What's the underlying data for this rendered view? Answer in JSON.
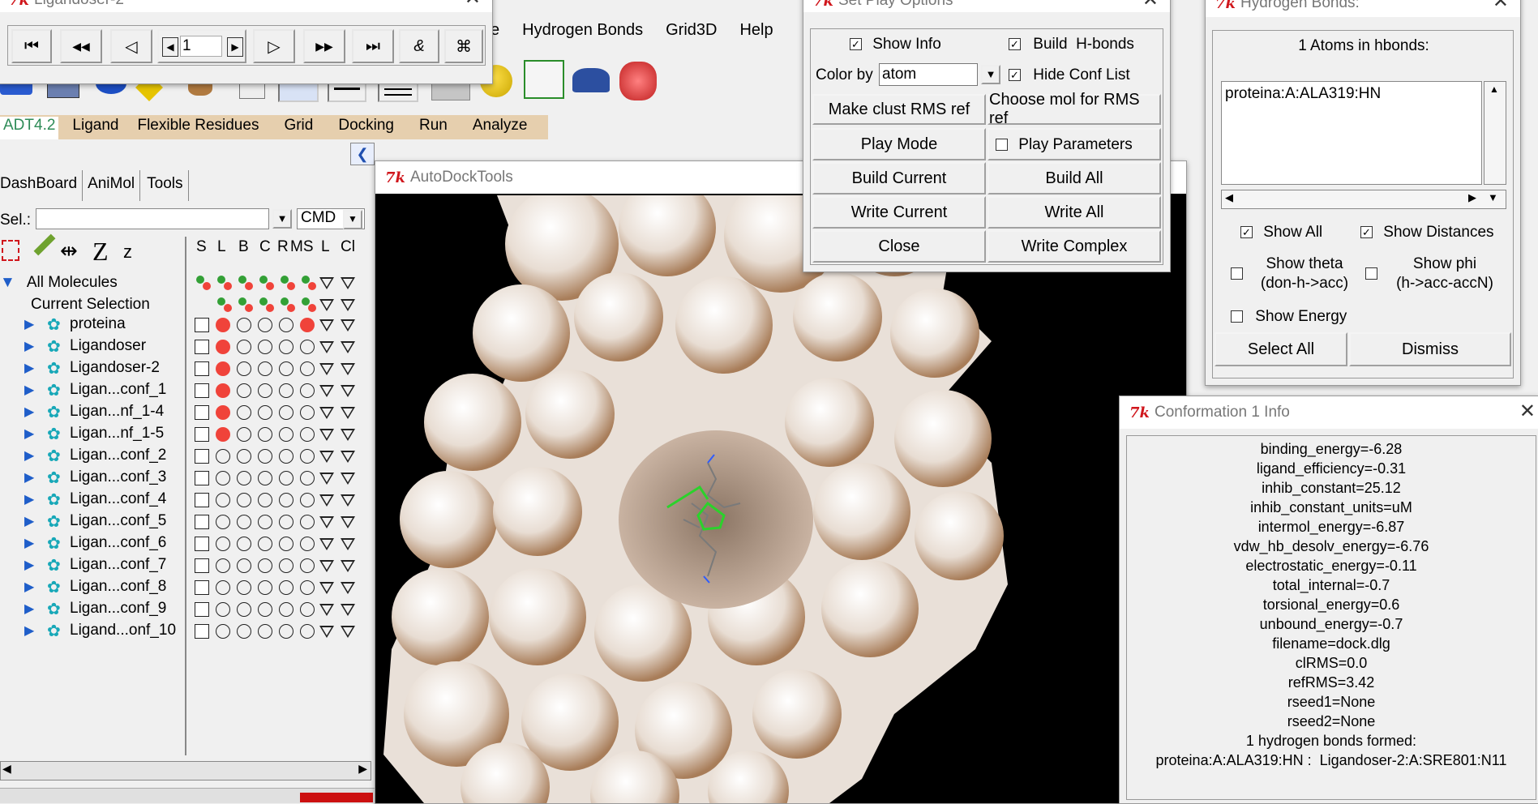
{
  "player": {
    "title": "Ligandoser-2",
    "frame_value": "1",
    "buttons": [
      "⏮",
      "◀◀",
      "◁",
      "▷",
      "▶▶",
      "⏭",
      "&",
      "⌘"
    ]
  },
  "menubar": {
    "items": [
      "e",
      "Hydrogen Bonds",
      "Grid3D",
      "Help"
    ]
  },
  "adt_tabs": [
    "ADT4.2",
    "Ligand",
    "Flexible Residues",
    "Grid",
    "Docking",
    "Run",
    "Analyze"
  ],
  "dash_tabs": [
    "DashBoard",
    "AniMol",
    "Tools"
  ],
  "sel": {
    "label": "Sel.:",
    "value": "",
    "cmd": "CMD"
  },
  "column_headers": [
    "S",
    "L",
    "B",
    "C",
    "R",
    "MS",
    "L",
    "Cl"
  ],
  "tree": {
    "root": "All Molecules",
    "current": "Current Selection",
    "molecules": [
      "proteina",
      "Ligandoser",
      "Ligandoser-2",
      "Ligan...conf_1",
      "Ligan...nf_1-4",
      "Ligan...nf_1-5",
      "Ligan...conf_2",
      "Ligan...conf_3",
      "Ligan...conf_4",
      "Ligan...conf_5",
      "Ligan...conf_6",
      "Ligan...conf_7",
      "Ligan...conf_8",
      "Ligan...conf_9",
      "Ligand...onf_10"
    ]
  },
  "viewer": {
    "title": "AutoDockTools"
  },
  "play_options": {
    "title": "Set Play Options",
    "show_info": "Show Info",
    "build_hbonds": "Build  H-bonds",
    "color_by_label": "Color by",
    "color_by_value": "atom",
    "hide_conf_list": "Hide Conf List",
    "make_clust": "Make clust RMS ref",
    "choose_mol": "Choose mol for RMS ref",
    "play_mode": "Play Mode",
    "play_parameters": "Play Parameters",
    "build_current": "Build Current",
    "build_all": "Build All",
    "write_current": "Write Current",
    "write_all": "Write All",
    "close": "Close",
    "write_complex": "Write Complex"
  },
  "hbonds": {
    "title": "Hydrogen Bonds:",
    "heading": "1 Atoms in hbonds:",
    "entry": "proteina:A:ALA319:HN",
    "show_all": "Show All",
    "show_distances": "Show Distances",
    "show_theta": "Show theta\n(don-h->acc)",
    "show_theta_1": "Show theta",
    "show_theta_2": "(don-h->acc)",
    "show_phi_1": "Show phi",
    "show_phi_2": "(h->acc-accN)",
    "show_energy": "Show Energy",
    "select_all": "Select All",
    "dismiss": "Dismiss"
  },
  "conf_info": {
    "title": "Conformation 1 Info",
    "lines": [
      "binding_energy=-6.28",
      "ligand_efficiency=-0.31",
      "inhib_constant=25.12",
      "inhib_constant_units=uM",
      "intermol_energy=-6.87",
      "vdw_hb_desolv_energy=-6.76",
      "electrostatic_energy=-0.11",
      "total_internal=-0.7",
      "torsional_energy=0.6",
      "unbound_energy=-0.7",
      "filename=dock.dlg",
      "clRMS=0.0",
      "refRMS=3.42",
      "rseed1=None",
      "rseed2=None",
      "1 hydrogen bonds formed:",
      "proteina:A:ALA319:HN :  Ligandoser-2:A:SRE801:N11"
    ]
  },
  "colors": {
    "tab_bar": "#e6cfae",
    "tk_red": "#d0161c",
    "selected_dot": "#f0433a",
    "green_dot": "#33a036"
  }
}
